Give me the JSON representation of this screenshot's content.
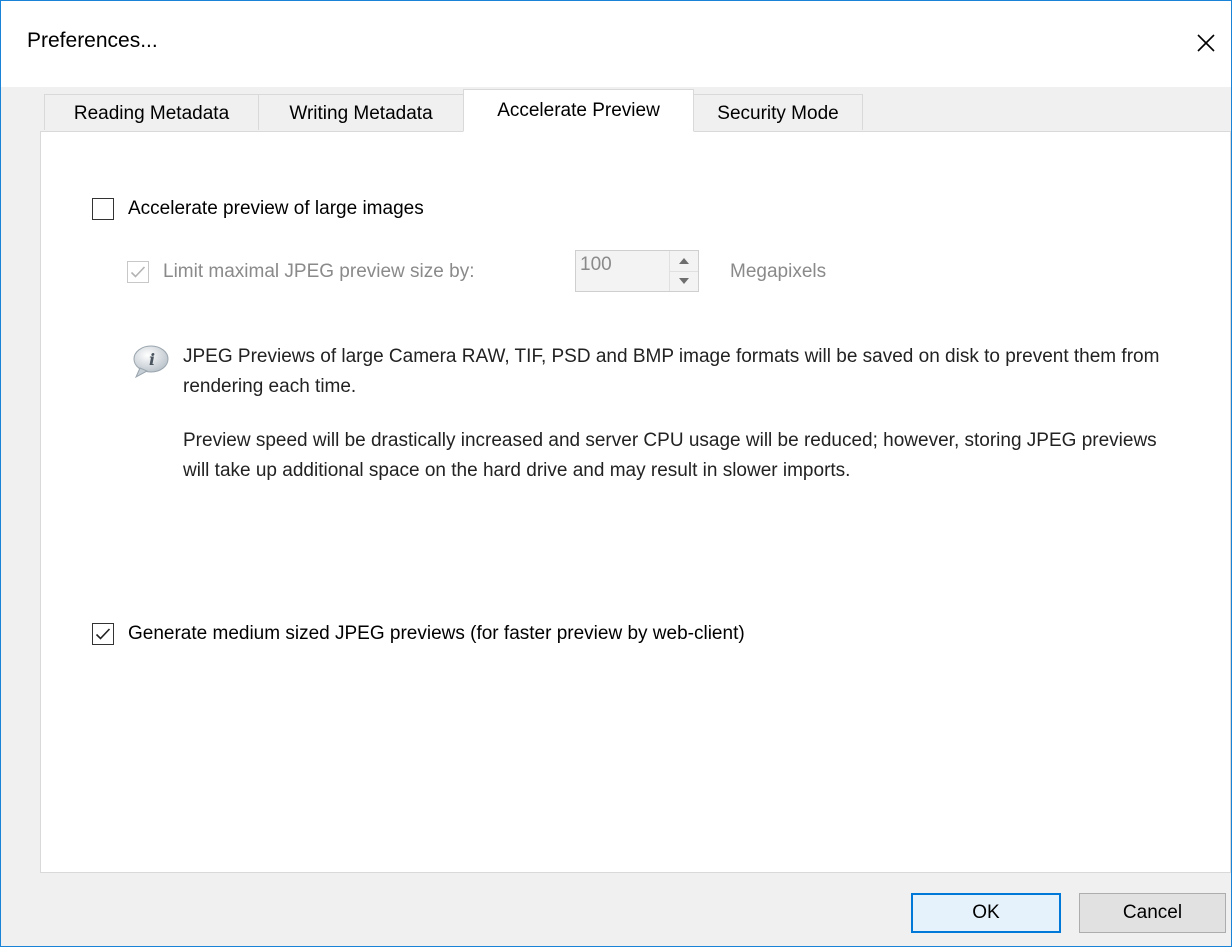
{
  "window": {
    "title": "Preferences...",
    "close_glyph": "×",
    "accent_color": "#0078d7"
  },
  "tabs": [
    {
      "label": "Reading Metadata",
      "active": false
    },
    {
      "label": "Writing Metadata",
      "active": false
    },
    {
      "label": "Accelerate Preview",
      "active": true
    },
    {
      "label": "Security Mode",
      "active": false
    }
  ],
  "accelerate": {
    "accelerate_label": "Accelerate preview of large images",
    "accelerate_checked": false,
    "limit_label": "Limit maximal JPEG preview size by:",
    "limit_checked": true,
    "limit_enabled": false,
    "limit_value": "100",
    "limit_unit": "Megapixels",
    "info_icon": "info-bubble-icon",
    "info_paragraph_1": "JPEG Previews of large Camera RAW, TIF, PSD and BMP image formats will be saved on disk to prevent them from rendering each time.",
    "info_paragraph_2": "Preview speed will be drastically increased and server CPU usage will be reduced; however, storing JPEG previews will take up additional space on the hard drive and may result in slower imports.",
    "medium_label": "Generate medium sized JPEG previews (for faster preview by web-client)",
    "medium_checked": true
  },
  "buttons": {
    "ok_label": "OK",
    "cancel_label": "Cancel"
  }
}
